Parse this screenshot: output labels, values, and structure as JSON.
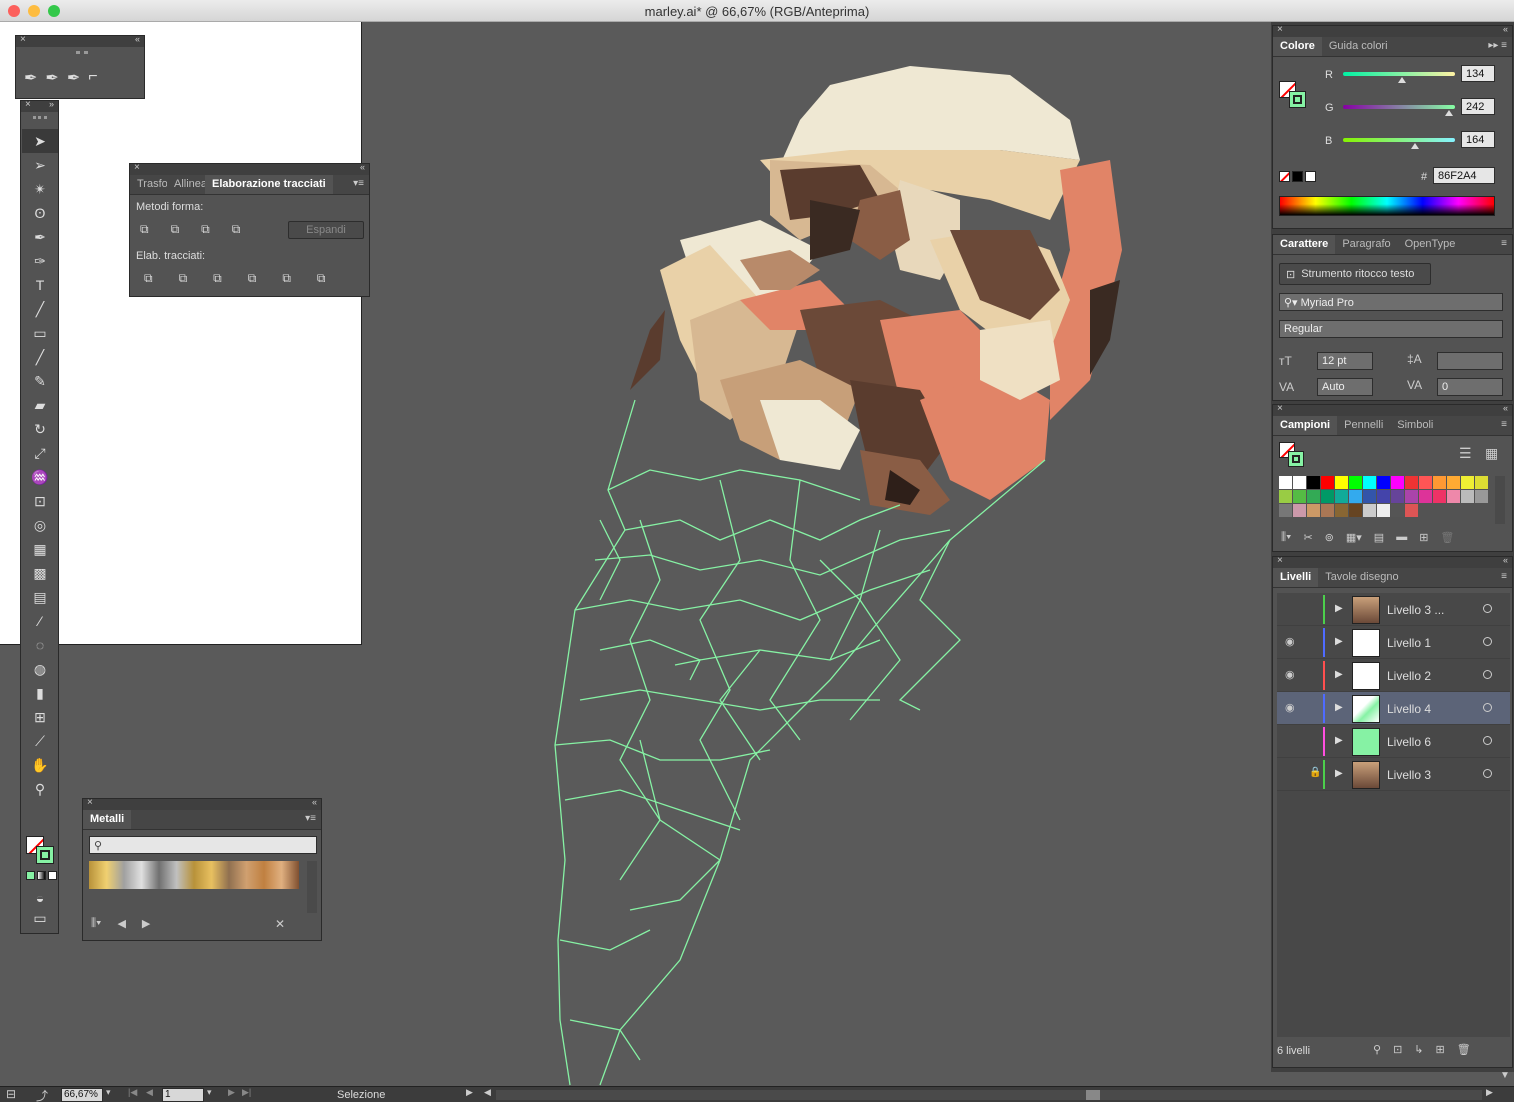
{
  "window": {
    "title": "marley.ai* @ 66,67% (RGB/Anteprima)",
    "colors": {
      "close": "#fc605c",
      "minimize": "#fdbc40",
      "zoom": "#34c84a"
    }
  },
  "path_panel": {
    "tabs": [
      "Trasfo",
      "Allinea",
      "Elaborazione tracciati"
    ],
    "shape_modes_label": "Metodi forma:",
    "expand_label": "Espandi",
    "pathfinders_label": "Elab. tracciati:"
  },
  "metals_panel": {
    "tab": "Metalli",
    "search_placeholder": ""
  },
  "color_panel": {
    "tabs": [
      "Colore",
      "Guida colori"
    ],
    "r_label": "R",
    "g_label": "G",
    "b_label": "B",
    "r": "134",
    "g": "242",
    "b": "164",
    "hash": "#",
    "hex": "86F2A4",
    "r_fraction": 0.525,
    "g_fraction": 0.949,
    "b_fraction": 0.643,
    "fill_color": "#86F2A4"
  },
  "char_panel": {
    "tabs": [
      "Carattere",
      "Paragrafo",
      "OpenType"
    ],
    "touch_tool": "Strumento ritocco testo",
    "font": "Myriad Pro",
    "style": "Regular",
    "size": "12 pt",
    "leading": "",
    "kerning": "Auto",
    "tracking": "0"
  },
  "swatches_panel": {
    "tabs": [
      "Campioni",
      "Pennelli",
      "Simboli"
    ]
  },
  "layers_panel": {
    "tabs": [
      "Livelli",
      "Tavole disegno"
    ],
    "layers": [
      {
        "name": "Livello 3 ...",
        "color": "#4ccf4c",
        "visible": false,
        "locked": false,
        "selected": false
      },
      {
        "name": "Livello 1",
        "color": "#4f6bff",
        "visible": true,
        "locked": false,
        "selected": false
      },
      {
        "name": "Livello 2",
        "color": "#ff4f4f",
        "visible": true,
        "locked": false,
        "selected": false
      },
      {
        "name": "Livello 4",
        "color": "#4f6bff",
        "visible": true,
        "locked": false,
        "selected": true
      },
      {
        "name": "Livello 6",
        "color": "#ff4fe0",
        "visible": false,
        "locked": false,
        "selected": false
      },
      {
        "name": "Livello 3",
        "color": "#4ccf4c",
        "visible": false,
        "locked": true,
        "selected": false
      }
    ],
    "count": "6 livelli"
  },
  "status": {
    "zoom": "66,67%",
    "artboard": "1",
    "tool": "Selezione"
  }
}
